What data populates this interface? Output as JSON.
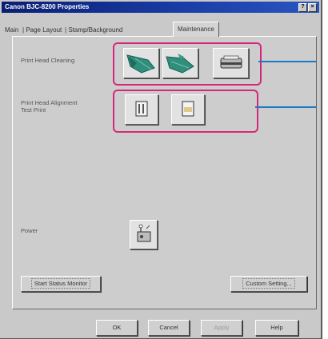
{
  "window": {
    "title": "Canon BJC-8200 Properties",
    "title_buttons": [
      "?",
      "×"
    ]
  },
  "tabs": [
    {
      "label": "Main"
    },
    {
      "label": "Page Layout"
    },
    {
      "label": "Stamp/Background"
    },
    {
      "label": "Maintenance",
      "active": true
    }
  ],
  "maintenance": {
    "head_cleaning_label": "Print Head Cleaning",
    "alignment_label_line1": "Print Head Alignment",
    "alignment_label_line2": "Test Print",
    "power_label": "Power",
    "start_status_monitor": "Start Status Monitor",
    "custom_setting": "Custom Setting..."
  },
  "footer": {
    "ok": "OK",
    "cancel": "Cancel",
    "apply": "Apply",
    "help": "Help"
  },
  "colors": {
    "highlight_box": "#d6287a",
    "callout_line": "#1b7ac8",
    "titlebar": "#0a1e74"
  }
}
